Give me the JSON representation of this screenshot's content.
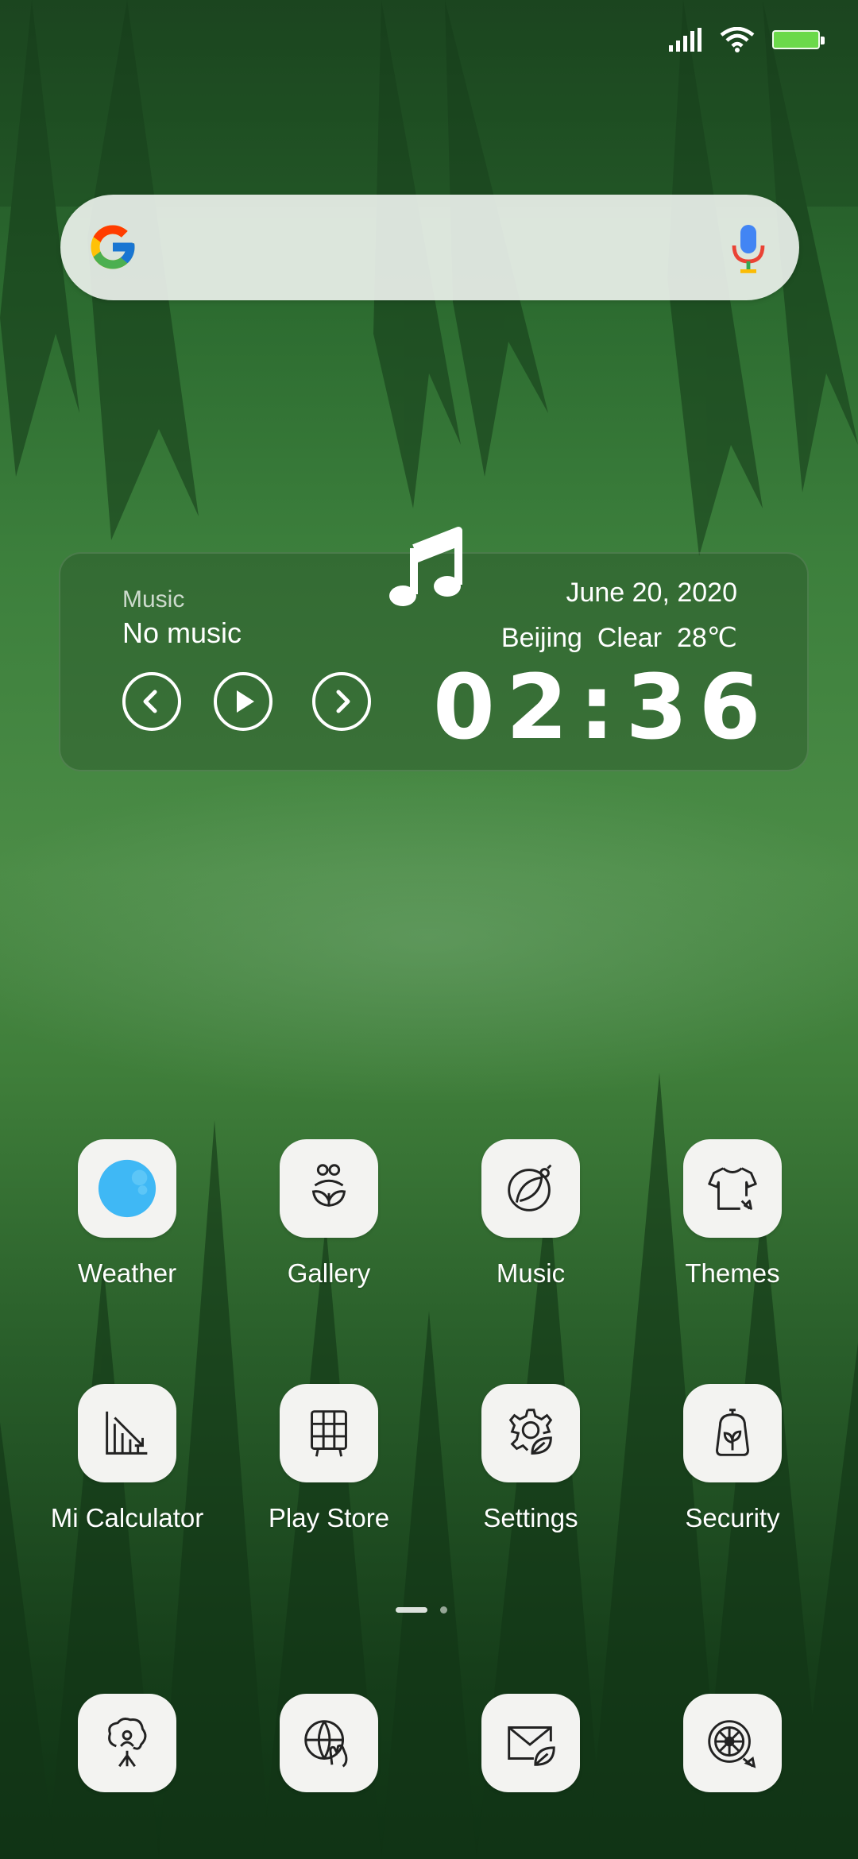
{
  "status_bar": {
    "signal_icon": "signal-icon",
    "wifi_icon": "wifi-icon",
    "battery_icon": "battery-icon",
    "battery_color": "#6bd94a"
  },
  "search": {
    "logo_icon": "google-g-icon",
    "mic_icon": "microphone-icon"
  },
  "widget": {
    "music_icon": "music-note-icon",
    "music_label": "Music",
    "song_title": "No music",
    "controls": [
      "previous-icon",
      "play-icon",
      "next-icon"
    ],
    "date": "June  20, 2020",
    "weather": "Beijing  Clear  28℃",
    "time": "02:36"
  },
  "apps": [
    {
      "label": "Weather",
      "icon": "weather-icon",
      "accent": "#3fb8f5"
    },
    {
      "label": "Gallery",
      "icon": "gallery-icon"
    },
    {
      "label": "Music",
      "icon": "music-app-icon"
    },
    {
      "label": "Themes",
      "icon": "tshirt-icon"
    },
    {
      "label": "Mi Calculator",
      "icon": "calculator-icon"
    },
    {
      "label": "Play Store",
      "icon": "basket-icon"
    },
    {
      "label": "Settings",
      "icon": "gear-leaf-icon"
    },
    {
      "label": "Security",
      "icon": "security-jar-icon"
    }
  ],
  "page_indicator": {
    "pages": 2,
    "current": 1
  },
  "dock": [
    {
      "icon": "tree-person-icon"
    },
    {
      "icon": "globe-hand-icon"
    },
    {
      "icon": "envelope-leaf-icon"
    },
    {
      "icon": "wheel-icon"
    }
  ]
}
